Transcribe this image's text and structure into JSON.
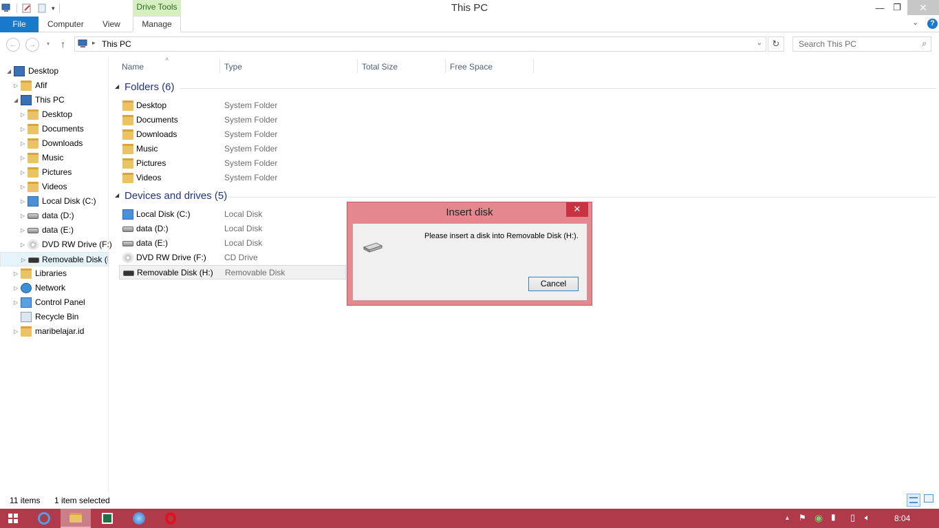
{
  "window": {
    "title": "This PC",
    "context_tab": "Drive Tools"
  },
  "ribbon": {
    "tabs": [
      "File",
      "Computer",
      "View",
      "Manage"
    ],
    "help": "?"
  },
  "address": {
    "path": "This PC",
    "search_placeholder": "Search This PC"
  },
  "nav_pane": {
    "items": [
      {
        "label": "Desktop"
      },
      {
        "label": "Afif"
      },
      {
        "label": "This PC"
      },
      {
        "label": "Desktop"
      },
      {
        "label": "Documents"
      },
      {
        "label": "Downloads"
      },
      {
        "label": "Music"
      },
      {
        "label": "Pictures"
      },
      {
        "label": "Videos"
      },
      {
        "label": "Local Disk (C:)"
      },
      {
        "label": "data  (D:)"
      },
      {
        "label": "data  (E:)"
      },
      {
        "label": "DVD RW Drive (F:)"
      },
      {
        "label": "Removable Disk (H"
      },
      {
        "label": "Libraries"
      },
      {
        "label": "Network"
      },
      {
        "label": "Control Panel"
      },
      {
        "label": "Recycle Bin"
      },
      {
        "label": "maribelajar.id"
      }
    ]
  },
  "columns": [
    "Name",
    "Type",
    "Total Size",
    "Free Space"
  ],
  "groups": {
    "folders_title": "Folders (6)",
    "folders": [
      {
        "name": "Desktop",
        "type": "System Folder"
      },
      {
        "name": "Documents",
        "type": "System Folder"
      },
      {
        "name": "Downloads",
        "type": "System Folder"
      },
      {
        "name": "Music",
        "type": "System Folder"
      },
      {
        "name": "Pictures",
        "type": "System Folder"
      },
      {
        "name": "Videos",
        "type": "System Folder"
      }
    ],
    "devices_title": "Devices and drives (5)",
    "devices": [
      {
        "name": "Local Disk (C:)",
        "type": "Local Disk"
      },
      {
        "name": "data  (D:)",
        "type": "Local Disk"
      },
      {
        "name": "data  (E:)",
        "type": "Local Disk"
      },
      {
        "name": "DVD RW Drive (F:)",
        "type": "CD Drive"
      },
      {
        "name": "Removable Disk (H:)",
        "type": "Removable Disk"
      }
    ]
  },
  "status": {
    "items": "11 items",
    "selected": "1 item selected"
  },
  "dialog": {
    "title": "Insert disk",
    "message": "Please insert a disk into Removable Disk (H:).",
    "cancel": "Cancel",
    "close": "✕"
  },
  "taskbar": {
    "clock": "8:04"
  },
  "colors": {
    "accent": "#1979ca",
    "taskbar": "#b03a4a",
    "dialog_frame": "#e5878f"
  }
}
